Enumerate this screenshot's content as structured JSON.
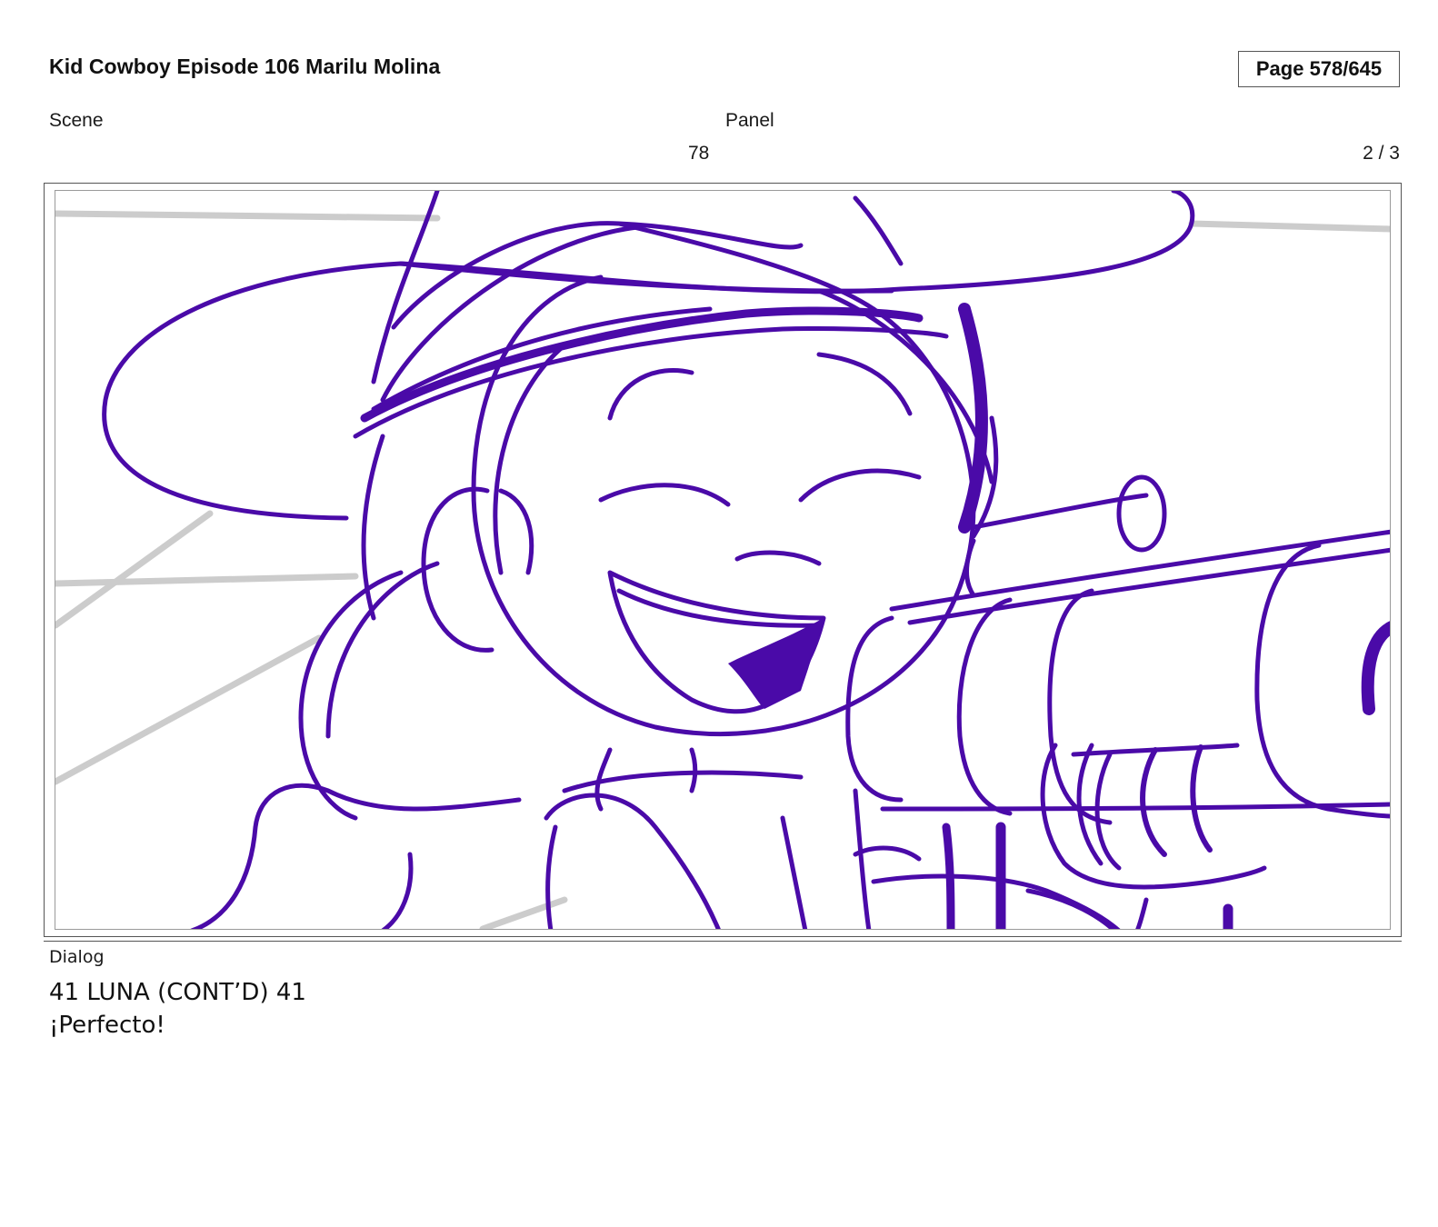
{
  "header": {
    "title": "Kid Cowboy Episode 106 Marilu Molina",
    "page": "Page 578/645"
  },
  "fields": {
    "scene_label": "Scene",
    "panel_label": "Panel",
    "scene_value": "78",
    "panel_value": "2 / 3"
  },
  "panel_image": {
    "description_icon": "storyboard-sketch",
    "stroke_color": "#4a0aa8",
    "background_lines_color": "#cccccc"
  },
  "dialog": {
    "label": "Dialog",
    "lines": [
      "41 LUNA (CONT’D) 41",
      "¡Perfecto!"
    ]
  }
}
